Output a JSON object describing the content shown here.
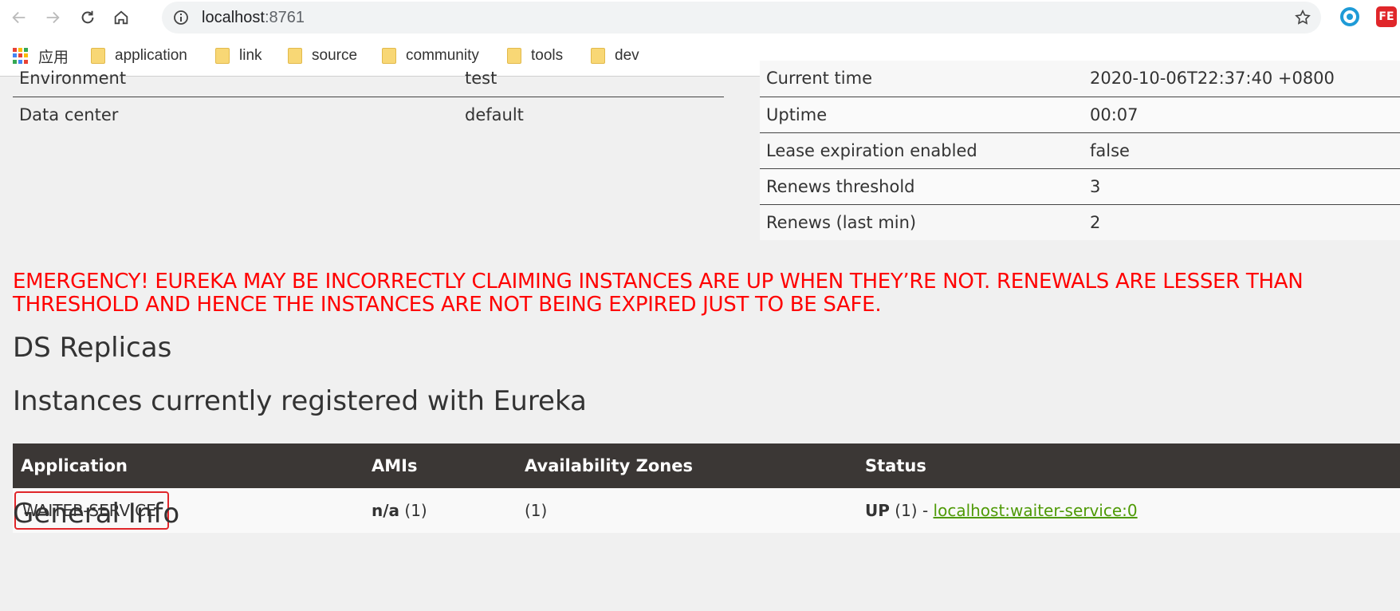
{
  "browser": {
    "url_host": "localhost",
    "url_port": ":8761",
    "bookmarks": [
      "应用",
      "application",
      "link",
      "source",
      "community",
      "tools",
      "dev"
    ]
  },
  "env_table": {
    "rows": [
      {
        "label": "Environment",
        "value": "test"
      },
      {
        "label": "Data center",
        "value": "default"
      }
    ]
  },
  "status_table": {
    "rows": [
      {
        "label": "Current time",
        "value": "2020-10-06T22:37:40 +0800"
      },
      {
        "label": "Uptime",
        "value": "00:07"
      },
      {
        "label": "Lease expiration enabled",
        "value": "false"
      },
      {
        "label": "Renews threshold",
        "value": "3"
      },
      {
        "label": "Renews (last min)",
        "value": "2"
      }
    ]
  },
  "emergency": "EMERGENCY! EUREKA MAY BE INCORRECTLY CLAIMING INSTANCES ARE UP WHEN THEY’RE NOT. RENEWALS ARE LESSER THAN THRESHOLD AND HENCE THE INSTANCES ARE NOT BEING EXPIRED JUST TO BE SAFE.",
  "sections": {
    "ds_replicas": "DS Replicas",
    "instances": "Instances currently registered with Eureka",
    "general_info": "General Info"
  },
  "instances": {
    "headers": [
      "Application",
      "AMIs",
      "Availability Zones",
      "Status"
    ],
    "rows": [
      {
        "application": "WAITER-SERVICE",
        "amis_bold": "n/a",
        "amis_count": " (1)",
        "zones": "(1)",
        "status_bold": "UP",
        "status_count": " (1) - ",
        "status_link": "localhost:waiter-service:0"
      }
    ]
  },
  "colors": {
    "emergency": "#ff0000",
    "table_header": "#3b3735",
    "link": "#4e9a06",
    "highlight_box": "#e0262a"
  }
}
